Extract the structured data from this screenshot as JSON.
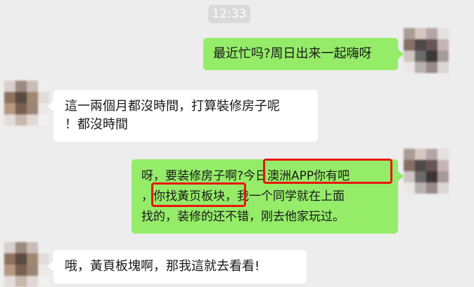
{
  "time_label": "12:33",
  "messages": [
    {
      "sender": "self",
      "lines": [
        "最近忙吗?周日出来一起嗨呀"
      ]
    },
    {
      "sender": "other",
      "lines": [
        "這一兩個月都沒時間，打算裝修房子呢",
        "！都沒時間"
      ]
    },
    {
      "sender": "self",
      "segments": {
        "l1_a": "呀，要装修房子啊?",
        "l1_hl": "今日澳洲APP你有吧",
        "l2_a": "，",
        "l2_hl": "你找黃页板块",
        "l2_b": "，我一个同学就在上面",
        "l3": "找的，装修的还不错，刚去他家玩过。"
      }
    },
    {
      "sender": "other",
      "lines": [
        "哦，黃頁板塊啊，那我這就去看看!"
      ]
    }
  ],
  "colors": {
    "background": "#ededed",
    "self_bubble": "#95ec69",
    "other_bubble": "#ffffff",
    "highlight_box": "#e8160e"
  }
}
